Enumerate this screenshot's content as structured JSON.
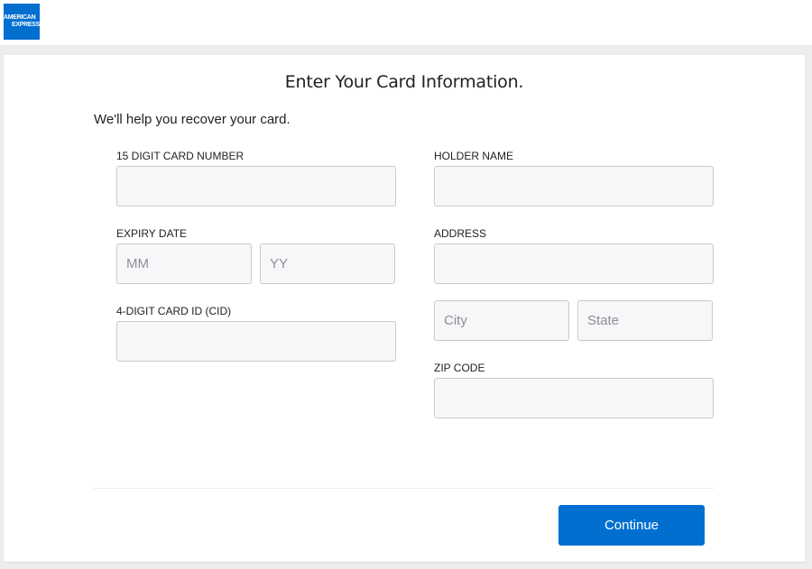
{
  "brand": {
    "logo_line1": "AMERICAN",
    "logo_line2": "EXPRESS",
    "color": "#016fd0"
  },
  "form": {
    "title": "Enter Your Card Information.",
    "subtitle": "We'll help you recover your card.",
    "fields": {
      "card_number": {
        "label": "15 DIGIT CARD NUMBER",
        "value": "",
        "placeholder": ""
      },
      "expiry_date": {
        "label": "EXPIRY DATE"
      },
      "expiry_month": {
        "value": "",
        "placeholder": "MM"
      },
      "expiry_year": {
        "value": "",
        "placeholder": "YY"
      },
      "cid": {
        "label": "4-DIGIT CARD ID (CID)",
        "value": "",
        "placeholder": ""
      },
      "holder_name": {
        "label": "HOLDER NAME",
        "value": "",
        "placeholder": ""
      },
      "address": {
        "label": "ADDRESS",
        "value": "",
        "placeholder": ""
      },
      "city": {
        "value": "",
        "placeholder": "City"
      },
      "state": {
        "value": "",
        "placeholder": "State"
      },
      "zip_code": {
        "label": "ZIP CODE",
        "value": "",
        "placeholder": ""
      }
    },
    "continue_label": "Continue",
    "button_color": "#006fcf"
  }
}
